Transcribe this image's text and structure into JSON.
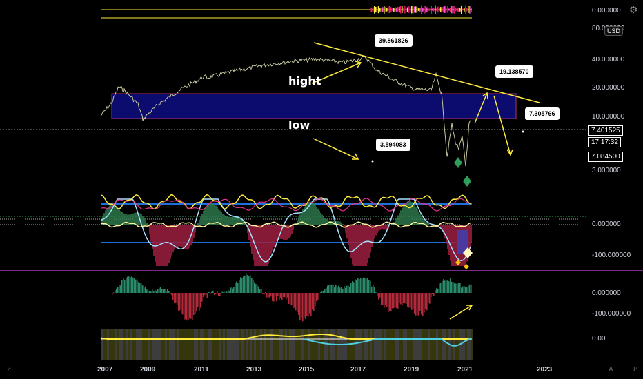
{
  "price_scale": {
    "top_pane_value": "0.000000",
    "main_ticks": [
      "80.000000",
      "40.000000",
      "20.000000",
      "10.000000",
      "3.000000"
    ],
    "current_price": "7.401525",
    "countdown": "17:17:32",
    "low_price": "7.084500",
    "currency": "USD",
    "osc1_ticks": [
      "0.000000",
      "-100.000000"
    ],
    "osc2_ticks": [
      "0.000000",
      "-100.000000"
    ],
    "osc3_ticks": [
      "0.00"
    ]
  },
  "annotations": {
    "hight": "hight",
    "low": "low",
    "callout_peak": "39.861826",
    "callout_low": "3.594083",
    "callout_target": "19.138570",
    "callout_right": "7.305766"
  },
  "time_axis": [
    "2007",
    "2009",
    "2011",
    "2013",
    "2015",
    "2017",
    "2019",
    "2021",
    "2023"
  ],
  "toolbar": {
    "left_corner": "Z",
    "auto": "A",
    "log": "B"
  },
  "colors": {
    "background": "#000000",
    "zone": "#0c0c6e",
    "zone_border": "#b03070",
    "trend": "#ffeb3b",
    "separator": "#7a2b8c",
    "price_line": "#c8c8a0"
  }
}
